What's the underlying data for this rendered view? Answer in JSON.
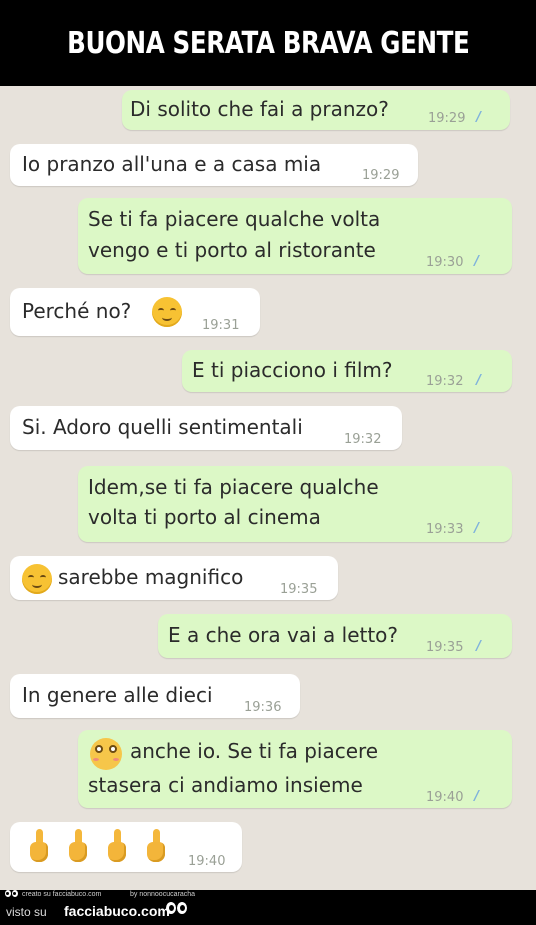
{
  "banner": {
    "title": "BUONA SERATA BRAVA GENTE"
  },
  "messages": [
    {
      "text": "Di solito che fai a pranzo?",
      "time": "19:29",
      "ticks": "//"
    },
    {
      "text": "Io pranzo all'una e a casa mia",
      "time": "19:29"
    },
    {
      "line1": "Se ti fa piacere qualche volta",
      "line2": "vengo e ti porto al ristorante",
      "time": "19:30",
      "ticks": "//"
    },
    {
      "text": "Perché no?",
      "emoji": "smiling-blush-emoji",
      "time": "19:31"
    },
    {
      "text": "E ti piacciono i film?",
      "time": "19:32",
      "ticks": "//"
    },
    {
      "text": "Si. Adoro quelli sentimentali",
      "time": "19:32"
    },
    {
      "line1": "Idem,se ti fa piacere qualche",
      "line2": "volta ti  porto al cinema",
      "time": "19:33",
      "ticks": "//"
    },
    {
      "text": "sarebbe magnifico",
      "emoji": "smiling-blush-emoji",
      "time": "19:35"
    },
    {
      "text": "E a che ora vai a letto?",
      "time": "19:35",
      "ticks": "//"
    },
    {
      "text": "In genere alle dieci",
      "time": "19:36"
    },
    {
      "line1": "anche io. Se ti fa piacere",
      "line2": "stasera ci andiamo insieme",
      "emoji": "flushed-face-emoji",
      "time": "19:40",
      "ticks": "//"
    },
    {
      "emoji": "middle-finger-emoji",
      "count": 4,
      "time": "19:40"
    }
  ],
  "footer": {
    "created": "creato su facciabuco.com",
    "by": "by nonnoocucaracha",
    "visto": "visto su",
    "brand": "facciabuco.com"
  },
  "colors": {
    "outgoing": "#dcf8c6",
    "incoming": "#ffffff",
    "background": "#e7e2db",
    "ticks": "#7fb2dc"
  }
}
